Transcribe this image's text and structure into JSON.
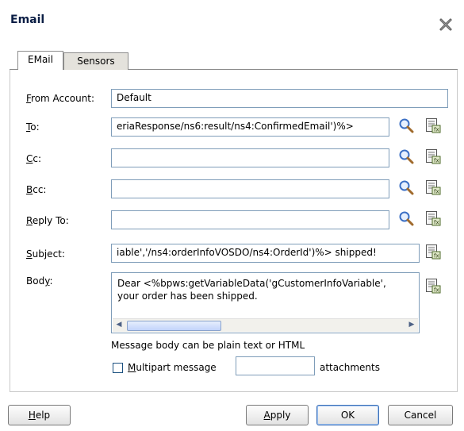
{
  "dialog": {
    "title": "Email"
  },
  "tabs": [
    {
      "label": "EMail",
      "active": true
    },
    {
      "label": "Sensors",
      "active": false
    }
  ],
  "form": {
    "from_account": {
      "label": "From Account:",
      "mnemonic": "F",
      "value": "Default"
    },
    "to": {
      "label": "To:",
      "mnemonic": "T",
      "value": "eriaResponse/ns6:result/ns4:ConfirmedEmail')%>"
    },
    "cc": {
      "label": "Cc:",
      "mnemonic": "C",
      "value": ""
    },
    "bcc": {
      "label": "Bcc:",
      "mnemonic": "B",
      "value": ""
    },
    "reply_to": {
      "label": "Reply To:",
      "mnemonic": "R",
      "value": ""
    },
    "subject": {
      "label": "Subject:",
      "mnemonic": "S",
      "value": "iable','/ns4:orderInfoVOSDO/ns4:OrderId')%> shipped!"
    },
    "body": {
      "label": "Body:",
      "mnemonic": "y",
      "line1": "Dear <%bpws:getVariableData('gCustomerInfoVariable',",
      "line2": "your order has been shipped."
    },
    "body_hint": "Message body can be plain text or HTML",
    "multipart": {
      "label": "Multipart message",
      "checked": false,
      "count": ""
    },
    "attachments_label": "attachments"
  },
  "buttons": {
    "help": "Help",
    "apply": "Apply",
    "ok": "OK",
    "cancel": "Cancel"
  },
  "icons": {
    "close": "close-icon",
    "search": "search-icon",
    "expression_builder": "expression-builder-icon"
  },
  "colors": {
    "title": "#0b1e45",
    "field_border": "#7f9db9",
    "search_glass": "#3b6fc4"
  }
}
